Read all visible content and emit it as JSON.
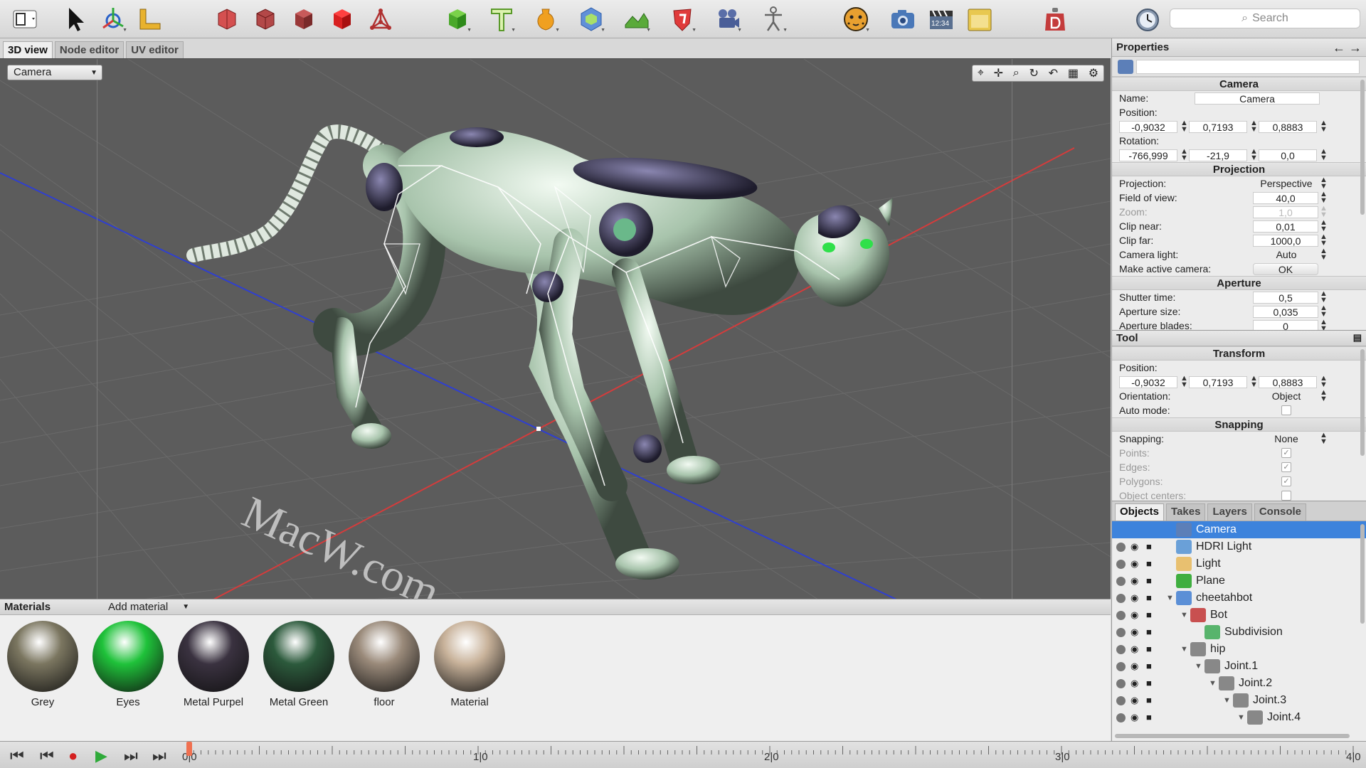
{
  "toolbar": {
    "search_placeholder": "Search",
    "tools": [
      "view-toggle",
      "select",
      "transform",
      "measure",
      "box-1",
      "box-2",
      "box-3",
      "box-4",
      "node",
      "cube",
      "text",
      "vase",
      "hexagon",
      "terrain",
      "shield",
      "camera-film",
      "figure",
      "cheetah",
      "photo-camera",
      "clapper",
      "folder",
      "dumbbell",
      "stopwatch"
    ],
    "clock_label": "12:34"
  },
  "viewport_tabs": [
    "3D view",
    "Node editor",
    "UV editor"
  ],
  "camera_select": "Camera",
  "watermark": "MacW.com",
  "materials": {
    "title": "Materials",
    "add_label": "Add material",
    "items": [
      {
        "name": "Grey",
        "color": "#7b7660"
      },
      {
        "name": "Eyes",
        "color": "#1fc23a"
      },
      {
        "name": "Metal Purpel",
        "color": "#3a3240"
      },
      {
        "name": "Metal Green",
        "color": "#2c5a3c"
      },
      {
        "name": "floor",
        "color": "#9a8a7a"
      },
      {
        "name": "Material",
        "color": "#c8b29a"
      }
    ]
  },
  "timeline": {
    "ticks": [
      "0|0",
      "1|0",
      "2|0",
      "3|0",
      "4|0"
    ]
  },
  "properties": {
    "title": "Properties",
    "camera": {
      "section": "Camera",
      "name_label": "Name:",
      "name_value": "Camera",
      "position_label": "Position:",
      "pos_x": "-0,9032",
      "pos_y": "0,7193",
      "pos_z": "0,8883",
      "rotation_label": "Rotation:",
      "rot_x": "-766,999",
      "rot_y": "-21,9",
      "rot_z": "0,0"
    },
    "projection": {
      "section": "Projection",
      "projection_label": "Projection:",
      "projection_value": "Perspective",
      "fov_label": "Field of view:",
      "fov_value": "40,0",
      "zoom_label": "Zoom:",
      "zoom_value": "1,0",
      "clip_near_label": "Clip near:",
      "clip_near_value": "0,01",
      "clip_far_label": "Clip far:",
      "clip_far_value": "1000,0",
      "camera_light_label": "Camera light:",
      "camera_light_value": "Auto",
      "active_label": "Make active camera:",
      "active_button": "OK"
    },
    "aperture": {
      "section": "Aperture",
      "shutter_label": "Shutter time:",
      "shutter_value": "0,5",
      "size_label": "Aperture size:",
      "size_value": "0,035",
      "blades_label": "Aperture blades:",
      "blades_value": "0"
    }
  },
  "tool": {
    "title": "Tool",
    "transform": {
      "section": "Transform",
      "position_label": "Position:",
      "pos_x": "-0,9032",
      "pos_y": "0,7193",
      "pos_z": "0,8883",
      "orientation_label": "Orientation:",
      "orientation_value": "Object",
      "auto_label": "Auto mode:"
    },
    "snapping": {
      "section": "Snapping",
      "snapping_label": "Snapping:",
      "snapping_value": "None",
      "points_label": "Points:",
      "edges_label": "Edges:",
      "polygons_label": "Polygons:",
      "centers_label": "Object centers:"
    }
  },
  "objects": {
    "tabs": [
      "Objects",
      "Takes",
      "Layers",
      "Console"
    ],
    "rows": [
      {
        "label": "Camera",
        "indent": 0,
        "icon_color": "#5c7fb8",
        "selected": true,
        "tri": ""
      },
      {
        "label": "HDRI Light",
        "indent": 0,
        "icon_color": "#6aa0d8",
        "selected": false,
        "tri": ""
      },
      {
        "label": "Light",
        "indent": 0,
        "icon_color": "#e8c070",
        "selected": false,
        "tri": ""
      },
      {
        "label": "Plane",
        "indent": 0,
        "icon_color": "#3fae3f",
        "selected": false,
        "tri": ""
      },
      {
        "label": "cheetahbot",
        "indent": 0,
        "icon_color": "#5b8fd6",
        "selected": false,
        "tri": "▼"
      },
      {
        "label": "Bot",
        "indent": 1,
        "icon_color": "#c85050",
        "selected": false,
        "tri": "▼"
      },
      {
        "label": "Subdivision",
        "indent": 2,
        "icon_color": "#58b46c",
        "selected": false,
        "tri": ""
      },
      {
        "label": "hip",
        "indent": 1,
        "icon_color": "#888888",
        "selected": false,
        "tri": "▼"
      },
      {
        "label": "Joint.1",
        "indent": 2,
        "icon_color": "#888888",
        "selected": false,
        "tri": "▼"
      },
      {
        "label": "Joint.2",
        "indent": 3,
        "icon_color": "#888888",
        "selected": false,
        "tri": "▼"
      },
      {
        "label": "Joint.3",
        "indent": 4,
        "icon_color": "#888888",
        "selected": false,
        "tri": "▼"
      },
      {
        "label": "Joint.4",
        "indent": 5,
        "icon_color": "#888888",
        "selected": false,
        "tri": "▼"
      }
    ]
  },
  "colors": {
    "accent": "#3d83dc",
    "viewport_bg": "#5c5c5c",
    "axis_x": "#d43c3c",
    "axis_z": "#2f3fd0"
  }
}
